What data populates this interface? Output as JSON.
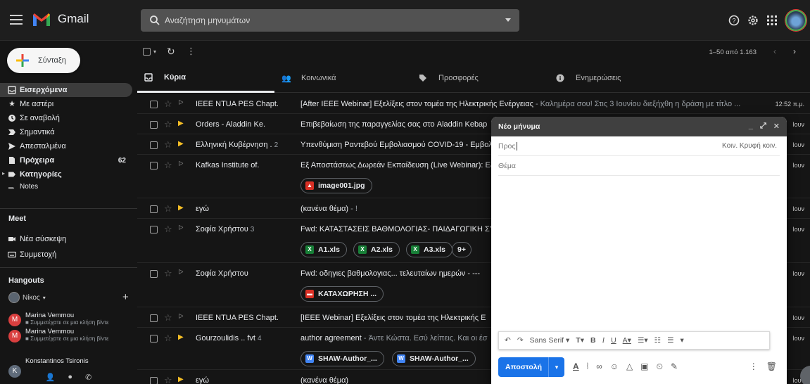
{
  "app": {
    "name": "Gmail"
  },
  "search": {
    "placeholder": "Αναζήτηση μηνυμάτων"
  },
  "compose_button": {
    "label": "Σύνταξη"
  },
  "nav": [
    {
      "label": "Εισερχόμενα",
      "icon": "inbox-icon",
      "active": true
    },
    {
      "label": "Με αστέρι",
      "icon": "star-icon"
    },
    {
      "label": "Σε αναβολή",
      "icon": "clock-icon"
    },
    {
      "label": "Σημαντικά",
      "icon": "important-icon"
    },
    {
      "label": "Απεσταλμένα",
      "icon": "send-icon"
    },
    {
      "label": "Πρόχειρα",
      "icon": "draft-icon",
      "count": "62",
      "bold": true
    },
    {
      "label": "Κατηγορίες",
      "icon": "label-icon",
      "bold": true
    },
    {
      "label": "Notes",
      "icon": "label-icon"
    }
  ],
  "meet": {
    "title": "Meet",
    "items": [
      {
        "label": "Νέα σύσκεψη"
      },
      {
        "label": "Συμμετοχή"
      }
    ]
  },
  "hangouts": {
    "title": "Hangouts",
    "user": "Νίκος",
    "contacts": [
      {
        "initial": "M",
        "name": "Marina Vemmou",
        "status": "Συμμετέχατε σε μια κλήση βίντε"
      },
      {
        "initial": "M",
        "name": "Marina Vemmou",
        "status": "Συμμετέχατε σε μια κλήση βίντε"
      },
      {
        "initial": "K",
        "name": "Konstantinos Tsironis",
        "status": ""
      }
    ]
  },
  "toolbar": {
    "pagination": "1–50 από 1.163"
  },
  "tabs": [
    {
      "label": "Κύρια",
      "active": true
    },
    {
      "label": "Κοινωνικά"
    },
    {
      "label": "Προσφορές"
    },
    {
      "label": "Ενημερώσεις"
    }
  ],
  "emails": [
    {
      "sender": "IEEE NTUA PES Chapt.",
      "count": "",
      "important": false,
      "subject": "[After IEEE Webinar] Εξελίξεις στον τομέα της Ηλεκτρικής Ενέργειας",
      "snippet": " - Καλημέρα σου! Στις 3 Ιουνίου διεξήχθη η δράση με τίτλο ...",
      "date": "12:52 π.μ.",
      "attachments": []
    },
    {
      "sender": "Orders - Aladdin Ke.",
      "count": "",
      "important": true,
      "subject": "Επιβεβαίωση της παραγγελίας σας στο Aladdin Kebap",
      "snippet": "",
      "date": "Ιουν",
      "attachments": []
    },
    {
      "sender": "Ελληνική Κυβέρνηση .",
      "count": "2",
      "important": true,
      "subject": "Υπενθύμιση Ραντεβού Εμβολιασμού COVID-19 - Εμβολι",
      "snippet": "",
      "date": "Ιουν",
      "attachments": []
    },
    {
      "sender": "Kafkas Institute of.",
      "count": "",
      "important": false,
      "subject": "Εξ Αποστάσεως Δωρεάν Εκπαίδευση (Live Webinar): Εξ",
      "snippet": "",
      "date": "Ιουν",
      "attachments": [
        {
          "name": "image001.jpg",
          "type": "img"
        }
      ]
    },
    {
      "sender": "εγώ",
      "count": "",
      "important": true,
      "subject": "(κανένα θέμα)",
      "snippet": " - !",
      "date": "Ιουν",
      "attachments": []
    },
    {
      "sender": "Σοφία Χρήστου",
      "count": "3",
      "important": false,
      "subject": "Fwd: ΚΑΤΑΣΤΑΣΕΙΣ ΒΑΘΜΟΛΟΓΙΑΣ- ΠΑΙΔΑΓΩΓΙΚΗ ΣΥΝ",
      "snippet": "",
      "date": "Ιουν",
      "attachments": [
        {
          "name": "A1.xls",
          "type": "xls"
        },
        {
          "name": "A2.xls",
          "type": "xls"
        },
        {
          "name": "A3.xls",
          "type": "xls"
        },
        {
          "name": "9+",
          "type": "more"
        }
      ]
    },
    {
      "sender": "Σοφία Χρήστου",
      "count": "",
      "important": false,
      "subject": "Fwd: οδηγιες βαθμολογιας... τελευταίων ημερών - ---",
      "snippet": "",
      "date": "Ιουν",
      "attachments": [
        {
          "name": "ΚΑΤΑΧΩΡΗΣΗ ...",
          "type": "pdf"
        }
      ]
    },
    {
      "sender": "IEEE NTUA PES Chapt.",
      "count": "",
      "important": false,
      "subject": "[IEEE Webinar] Εξελίξεις στον τομέα της Ηλεκτρικής Ε",
      "snippet": "",
      "date": "Ιουν",
      "attachments": []
    },
    {
      "sender": "Gourzoulidis .. fvt",
      "count": "4",
      "important": true,
      "subject": "author agreement",
      "snippet": " - Άντε Κώστα. Εσύ λείπεις. Και οι έσ",
      "date": "Ιουν",
      "attachments": [
        {
          "name": "SHAW-Author_...",
          "type": "doc"
        },
        {
          "name": "SHAW-Author_...",
          "type": "doc"
        }
      ]
    },
    {
      "sender": "εγώ",
      "count": "",
      "important": true,
      "subject": "(κανένα θέμα)",
      "snippet": "",
      "date": "Ιουν",
      "attachments": []
    }
  ],
  "compose": {
    "title": "Νέο μήνυμα",
    "to_label": "Προς",
    "cc_bcc": "Κοιν. Κρυφή κοιν.",
    "subject_placeholder": "Θέμα",
    "font": "Sans Serif",
    "send_label": "Αποστολή"
  },
  "colors": {
    "accent": "#1a73e8",
    "background": "#151515",
    "topbar": "#1e1e1e",
    "compose_header": "#404040"
  }
}
